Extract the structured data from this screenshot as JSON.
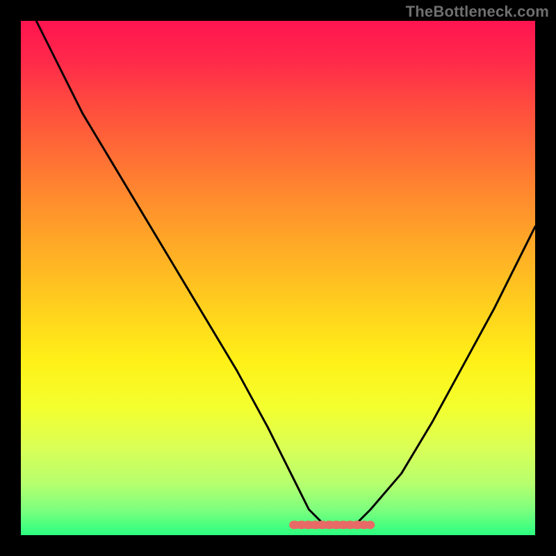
{
  "attribution": "TheBottleneck.com",
  "colors": {
    "frame": "#000000",
    "curve_stroke": "#000000",
    "marker_stroke": "#e86a66",
    "gradient_stops": [
      "#ff1450",
      "#ff8a2e",
      "#fff018",
      "#2bff80"
    ]
  },
  "chart_data": {
    "type": "line",
    "title": "",
    "xlabel": "",
    "ylabel": "",
    "xlim": [
      0,
      100
    ],
    "ylim": [
      0,
      100
    ],
    "grid": false,
    "legend": false,
    "annotations": [],
    "series": [
      {
        "name": "bottleneck-curve",
        "x": [
          3,
          8,
          12,
          18,
          24,
          30,
          36,
          42,
          48,
          53,
          56,
          59,
          62,
          65,
          68,
          74,
          80,
          86,
          92,
          100
        ],
        "values": [
          100,
          90,
          82,
          72,
          62,
          52,
          42,
          32,
          21,
          11,
          5,
          2,
          2,
          2,
          5,
          12,
          22,
          33,
          44,
          60
        ]
      }
    ],
    "bottom_band": {
      "x_start": 53,
      "x_end": 68,
      "y": 2
    }
  }
}
